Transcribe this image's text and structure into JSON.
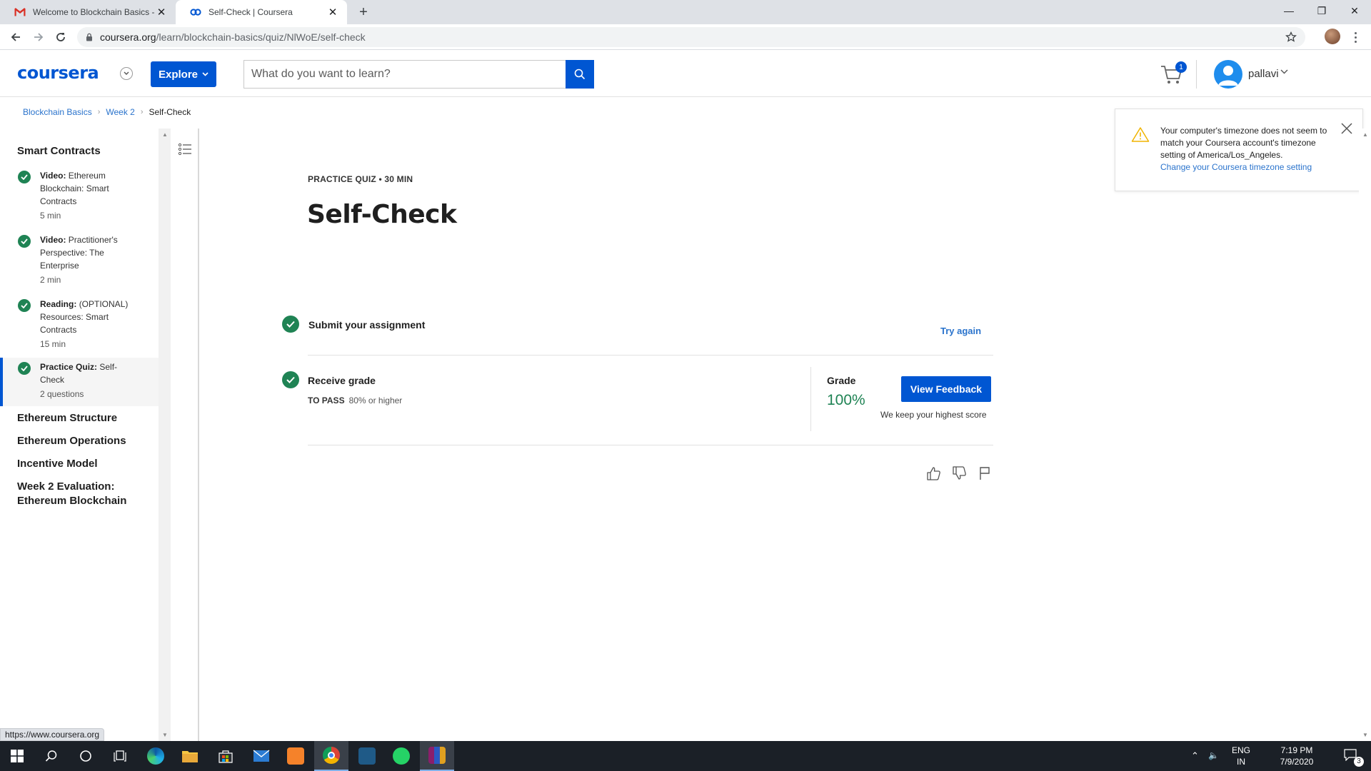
{
  "browser": {
    "tabs": [
      {
        "title": "Welcome to Blockchain Basics - B",
        "active": false
      },
      {
        "title": "Self-Check | Coursera",
        "active": true
      }
    ],
    "url_domain": "coursera.org",
    "url_path": "/learn/blockchain-basics/quiz/NlWoE/self-check",
    "status_url": "https://www.coursera.org"
  },
  "header": {
    "logo": "coursera",
    "explore_label": "Explore",
    "search_placeholder": "What do you want to learn?",
    "cart_count": "1",
    "user_name": "pallavi"
  },
  "breadcrumb": [
    {
      "label": "Blockchain Basics",
      "link": true
    },
    {
      "label": "Week 2",
      "link": true
    },
    {
      "label": "Self-Check",
      "link": false
    }
  ],
  "sidebar": {
    "current_section": "Smart Contracts",
    "lessons": [
      {
        "type": "Video:",
        "title": "Ethereum Blockchain: Smart Contracts",
        "duration": "5 min",
        "completed": true,
        "active": false
      },
      {
        "type": "Video:",
        "title": "Practitioner's Perspective: The Enterprise",
        "duration": "2 min",
        "completed": true,
        "active": false
      },
      {
        "type": "Reading:",
        "title": "(OPTIONAL) Resources: Smart Contracts",
        "duration": "15 min",
        "completed": true,
        "active": false
      },
      {
        "type": "Practice Quiz:",
        "title": "Self-Check",
        "duration": "2 questions",
        "completed": true,
        "active": true
      }
    ],
    "sections": [
      "Ethereum Structure",
      "Ethereum Operations",
      "Incentive Model",
      "Week 2 Evaluation: Ethereum Blockchain"
    ]
  },
  "quiz": {
    "eyebrow": "PRACTICE QUIZ • 30 MIN",
    "title": "Self-Check",
    "submit_label": "Submit your assignment",
    "try_again": "Try again",
    "receive_label": "Receive grade",
    "to_pass_label": "TO PASS",
    "to_pass_value": "80% or higher",
    "grade_label": "Grade",
    "grade_value": "100%",
    "view_feedback": "View Feedback",
    "highest_note": "We keep your highest score"
  },
  "toast": {
    "message": "Your computer's timezone does not seem to match your Coursera account's timezone setting of America/Los_Angeles.",
    "link": "Change your Coursera timezone setting"
  },
  "taskbar": {
    "lang": "ENG",
    "region": "IN",
    "time": "7:19 PM",
    "date": "7/9/2020",
    "notifications": "3"
  },
  "colors": {
    "brand": "#0056d2",
    "success": "#1f8354",
    "link": "#2a73cc",
    "warning": "#f0b400"
  }
}
